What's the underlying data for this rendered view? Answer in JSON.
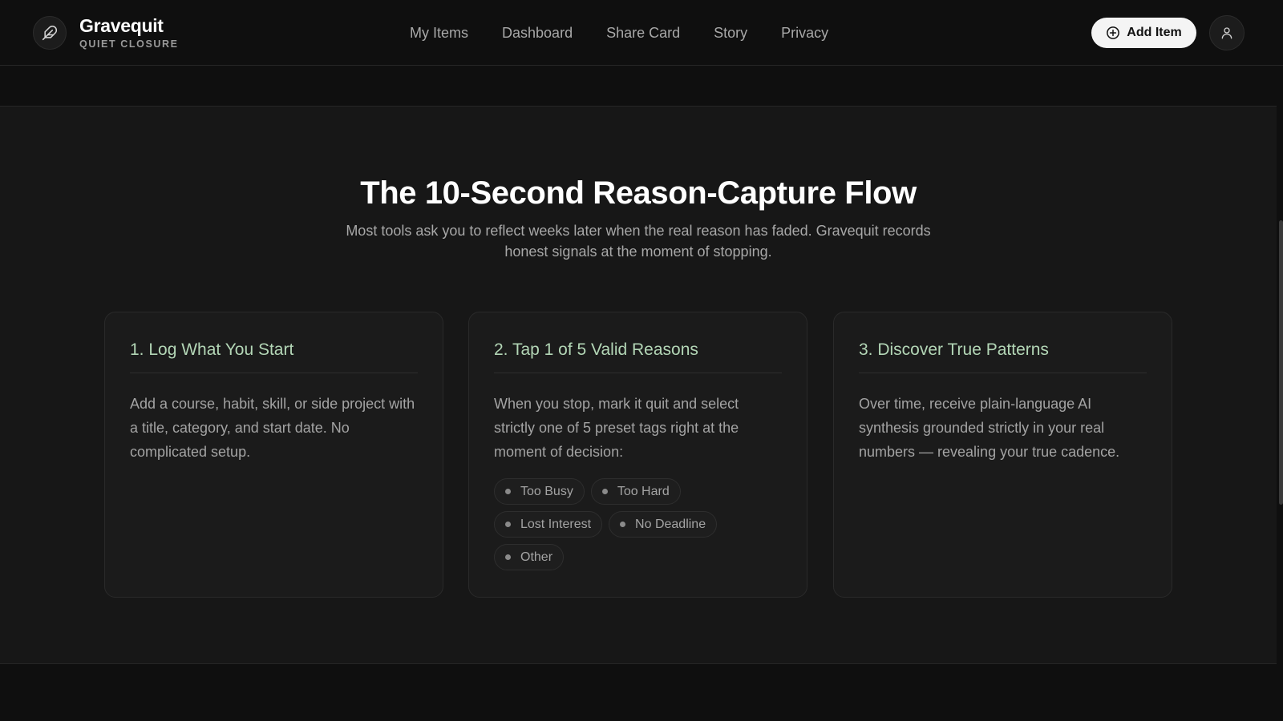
{
  "brand": {
    "name": "Gravequit",
    "tagline": "QUIET CLOSURE",
    "logo_icon": "feather-icon"
  },
  "nav": {
    "items": [
      {
        "label": "My Items"
      },
      {
        "label": "Dashboard"
      },
      {
        "label": "Share Card"
      },
      {
        "label": "Story"
      },
      {
        "label": "Privacy"
      }
    ]
  },
  "header_actions": {
    "add_label": "Add Item",
    "add_icon": "plus-circle-icon",
    "user_icon": "user-icon"
  },
  "section": {
    "title": "The 10-Second Reason-Capture Flow",
    "subtitle": "Most tools ask you to reflect weeks later when the real reason has faded. Gravequit records honest signals at the moment of stopping."
  },
  "cards": [
    {
      "title": "1. Log What You Start",
      "body": "Add a course, habit, skill, or side project with a title, category, and start date. No complicated setup."
    },
    {
      "title": "2. Tap 1 of 5 Valid Reasons",
      "body": "When you stop, mark it quit and select strictly one of 5 preset tags right at the moment of decision:",
      "tags": [
        "Too Busy",
        "Too Hard",
        "Lost Interest",
        "No Deadline",
        "Other"
      ]
    },
    {
      "title": "3. Discover True Patterns",
      "body": "Over time, receive plain-language AI synthesis grounded strictly in your real numbers — revealing your true cadence."
    }
  ],
  "colors": {
    "accent_green": "#b3d6b6",
    "background": "#0f0f0f",
    "section": "#171717"
  }
}
